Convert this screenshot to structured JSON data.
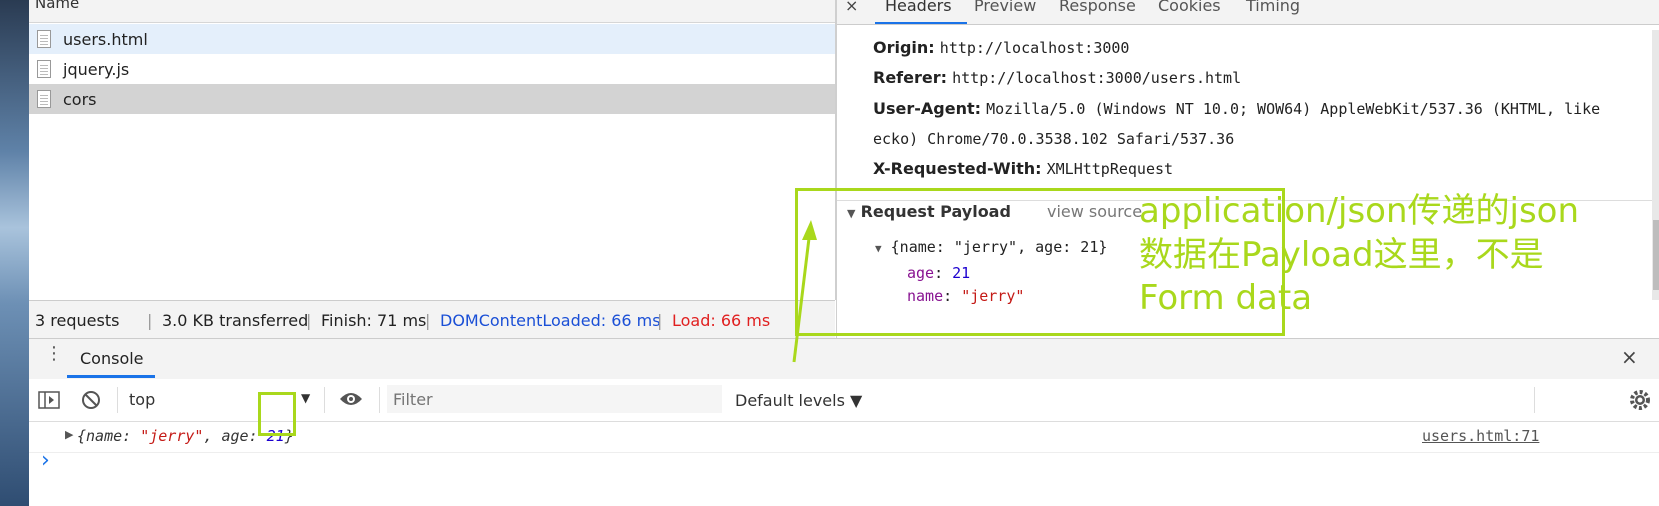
{
  "network": {
    "column_header": "Name",
    "files": [
      {
        "name": "users.html",
        "state": "selected"
      },
      {
        "name": "jquery.js",
        "state": "normal"
      },
      {
        "name": "cors",
        "state": "highlighted"
      }
    ],
    "status": {
      "requests": "3 requests",
      "transferred": "3.0 KB transferred",
      "finish": "Finish: 71 ms",
      "domcontentloaded": "DOMContentLoaded: 66 ms",
      "load": "Load: 66 ms",
      "separator": "|"
    }
  },
  "detail": {
    "close": "×",
    "tabs": [
      "Headers",
      "Preview",
      "Response",
      "Cookies",
      "Timing"
    ],
    "headers": [
      {
        "key": "Origin:",
        "value": "http://localhost:3000"
      },
      {
        "key": "Referer:",
        "value": "http://localhost:3000/users.html"
      },
      {
        "key": "User-Agent:",
        "value": "Mozilla/5.0 (Windows NT 10.0; WOW64) AppleWebKit/537.36 (KHTML, like"
      },
      {
        "key": "",
        "value": "ecko) Chrome/70.0.3538.102 Safari/537.36"
      },
      {
        "key": "X-Requested-With:",
        "value": "XMLHttpRequest"
      }
    ],
    "payload": {
      "title": "Request Payload",
      "view_source": "view source",
      "summary": "{name: \"jerry\", age: 21}",
      "age_key": "age",
      "age_value": "21",
      "name_key": "name",
      "name_value": "\"jerry\""
    }
  },
  "annotation": {
    "line1": "application/json传递的json",
    "line2": "数据在Payload这里，不是",
    "line3": "Form  data",
    "color": "#a9d81c"
  },
  "console": {
    "tab": "Console",
    "close": "×",
    "context": "top",
    "filter_placeholder": "Filter",
    "levels": "Default levels ▼",
    "log": {
      "open": "{name: ",
      "name_value": "\"jerry\"",
      "mid": ", age: ",
      "age_value": "21",
      "close": "}",
      "source": "users.html:71"
    },
    "prompt": "›"
  }
}
